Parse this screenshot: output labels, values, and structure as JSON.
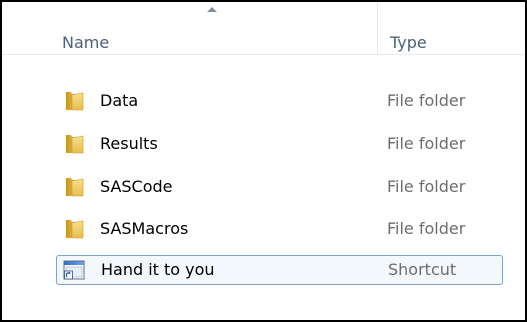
{
  "columns": {
    "name": "Name",
    "type": "Type",
    "sorted_column": "name",
    "sort_direction": "ascending"
  },
  "files": [
    {
      "name": "Data",
      "type": "File folder",
      "icon": "folder-icon",
      "selected": false
    },
    {
      "name": "Results",
      "type": "File folder",
      "icon": "folder-icon",
      "selected": false
    },
    {
      "name": "SASCode",
      "type": "File folder",
      "icon": "folder-icon",
      "selected": false
    },
    {
      "name": "SASMacros",
      "type": "File folder",
      "icon": "folder-icon",
      "selected": false
    },
    {
      "name": "Hand it to you",
      "type": "Shortcut",
      "icon": "shortcut-icon",
      "selected": true
    }
  ],
  "colors": {
    "header_text": "#4c607a",
    "type_text": "#6d6d6d",
    "selection_border": "#7da2ce",
    "folder": "#e8c25a"
  }
}
